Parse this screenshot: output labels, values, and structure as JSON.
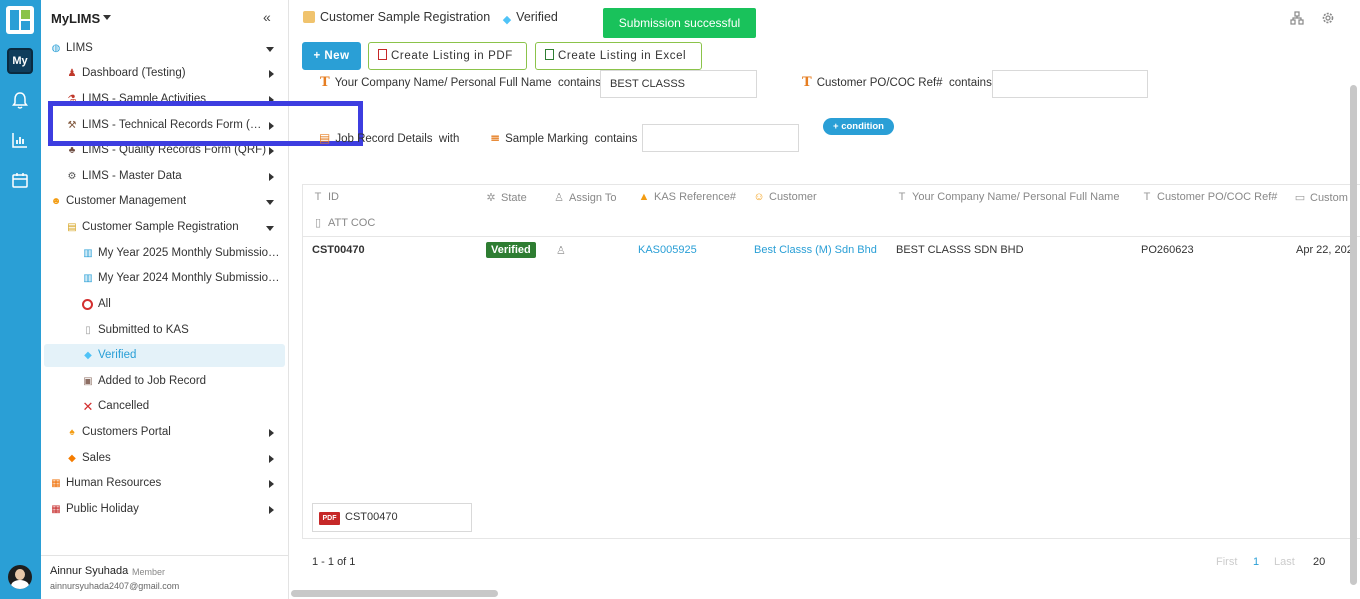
{
  "app": {
    "name": "MyLIMS",
    "rail_badge": "My"
  },
  "sidebar": {
    "items": [
      {
        "label": "LIMS",
        "icon": "globe-icon"
      },
      {
        "label": "Dashboard (Testing)",
        "icon": "chart-person-icon"
      },
      {
        "label": "LIMS - Sample Activities",
        "icon": "flask-icon"
      },
      {
        "label": "LIMS - Technical Records Form (T...",
        "icon": "tools-icon"
      },
      {
        "label": "LIMS - Quality Records Form (QRF)",
        "icon": "quality-icon"
      },
      {
        "label": "LIMS - Master Data",
        "icon": "gear-icon"
      },
      {
        "label": "Customer Management",
        "icon": "smiley-icon"
      },
      {
        "label": "Customer Sample Registration",
        "icon": "scroll-icon"
      },
      {
        "label": "My Year 2025 Monthly Submission...",
        "icon": "bar-chart-icon"
      },
      {
        "label": "My Year 2024 Monthly Submission...",
        "icon": "bar-chart-icon"
      },
      {
        "label": "All",
        "icon": "circle-icon"
      },
      {
        "label": "Submitted to KAS",
        "icon": "document-icon"
      },
      {
        "label": "Verified",
        "icon": "diamond-icon"
      },
      {
        "label": "Added to Job Record",
        "icon": "inbox-icon"
      },
      {
        "label": "Cancelled",
        "icon": "cross-icon"
      },
      {
        "label": "Customers Portal",
        "icon": "people-icon"
      },
      {
        "label": "Sales",
        "icon": "orange-diamond-icon"
      },
      {
        "label": "Human Resources",
        "icon": "sunset-icon"
      },
      {
        "label": "Public Holiday",
        "icon": "calendar-icon"
      }
    ],
    "user": {
      "name": "Ainnur Syuhada",
      "role": "Member",
      "email": "ainnursyuhada2407@gmail.com"
    }
  },
  "header": {
    "breadcrumb_page": "Customer Sample Registration",
    "breadcrumb_view": "Verified",
    "toast": "Submission successful"
  },
  "toolbar": {
    "new_label": "+ New",
    "pdf_label": "Create Listing in PDF",
    "excel_label": "Create Listing in Excel"
  },
  "filters": {
    "company_label": "Your Company Name/ Personal Full Name",
    "company_op": "contains",
    "company_value": "BEST CLASSS",
    "po_label": "Customer PO/COC Ref#",
    "po_op": "contains",
    "po_value": "",
    "job_label": "Job Record Details",
    "job_op": "with",
    "marking_label": "Sample Marking",
    "marking_op": "contains",
    "marking_value": "",
    "add_condition": "+ condition"
  },
  "table": {
    "columns": [
      "ID",
      "State",
      "Assign To",
      "KAS Reference#",
      "Customer",
      "Your Company Name/ Personal Full Name",
      "Customer PO/COC Ref#",
      "Custom",
      "ATT COC"
    ],
    "rows": [
      {
        "id": "CST00470",
        "state": "Verified",
        "kas_ref": "KAS005925",
        "customer": "Best Classs (M) Sdn Bhd",
        "company": "BEST CLASSS SDN BHD",
        "po_ref": "PO260623",
        "date": "Apr 22, 202",
        "att_file": "CST00470",
        "att_type": "PDF"
      }
    ]
  },
  "pagination": {
    "summary": "1 - 1 of 1",
    "first": "First",
    "page": "1",
    "last": "Last",
    "page_size": "20"
  },
  "colors": {
    "accent": "#2a9fd6",
    "toast_bg": "#19c25b",
    "verified_badge": "#2e7d32",
    "highlight_box": "#3d3de0"
  }
}
